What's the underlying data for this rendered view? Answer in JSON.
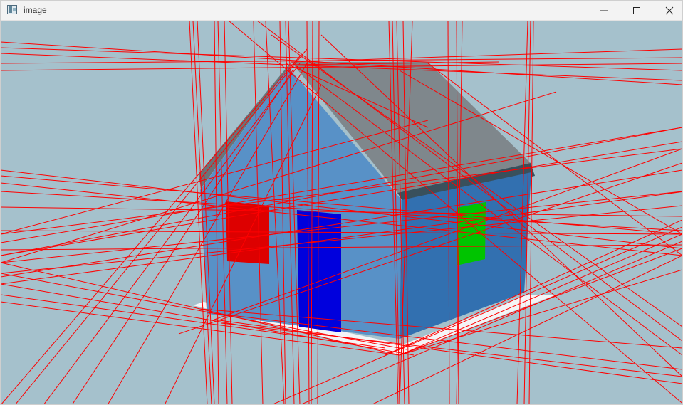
{
  "window": {
    "title": "image",
    "icon": "app-image-icon",
    "controls": [
      "minimize-icon",
      "maximize-icon",
      "close-icon"
    ]
  },
  "scene": {
    "background_color": "#a5c1cc",
    "house": {
      "front_wall_color": "#5891c7",
      "side_wall_color": "#3270b0",
      "roof_color": "#7f878c",
      "roof_edge_color": "#39505c",
      "door_color": "#0000dd",
      "left_window_color": "#dd0000",
      "right_window_color": "#00c400",
      "ground_color": "#f4f4f6"
    },
    "overlay_line_color": "#ff0000"
  }
}
